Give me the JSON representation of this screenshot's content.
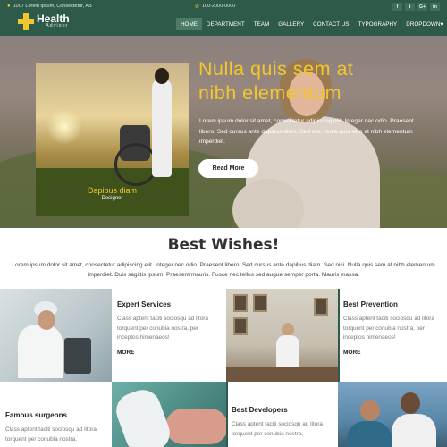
{
  "topbar": {
    "address": "1007 Lorem ipsum, Consectetur, AB",
    "phone": "100-2000-0000",
    "social": [
      "f",
      "t",
      "G+",
      "in"
    ]
  },
  "logo": {
    "brand": "Health",
    "tagline": "Advisor"
  },
  "nav": [
    "HOME",
    "DEPARTMENT",
    "TEAM",
    "GALLERY",
    "CONTACT US",
    "TYPOGRAPHY",
    "DROPDOWN▾"
  ],
  "hero": {
    "title_line1": "Nulla quis sem at",
    "title_line2": "nibh elementum",
    "text": "Lorem ipsum dolor sit amet, consectetur adipiscing elit. Integer nec odio. Praesent libero. Sed cursus ante dapibus diam. Sed nisi. Nulla quis sem at nibh elementum imperdiet.",
    "button": "Read More",
    "caption_name": "Dapibus diam",
    "caption_role": "Designer"
  },
  "wishes": {
    "title": "Best Wishes!",
    "text": "Lorem ipsum dolor sit amet, consectetur adipiscing elit. Integer nec odio. Praesent libero. Sed cursus ante dapibus diam. Sed nisi. Nulla quis sem at nibh elementum imperdiet. Duis sagittis ipsum. Praesent mauris. Fusce nec tellus sed augue semper porta. Mauris massa."
  },
  "tiles": [
    {
      "title": "Expert Services",
      "text": "Class aptent taciti sociosqu ad litora torquent per conubia nostra, per inceptos himenaeos!",
      "more": "MORE"
    },
    {
      "title": "Best Prevention",
      "text": "Class aptent taciti sociosqu ad litora torquent per conubia nostra, per inceptos himenaeos!",
      "more": "MORE"
    },
    {
      "title": "Famous surgeons",
      "text": "Class aptent taciti sociosqu ad litora torquent per conubia nostra,"
    },
    {
      "title": "Best Developers",
      "text": "Class aptent taciti sociosqu ad litora torquent per conubia nostra,"
    }
  ],
  "colors": {
    "header": "#2e5b49",
    "accent": "#f3c72b"
  }
}
